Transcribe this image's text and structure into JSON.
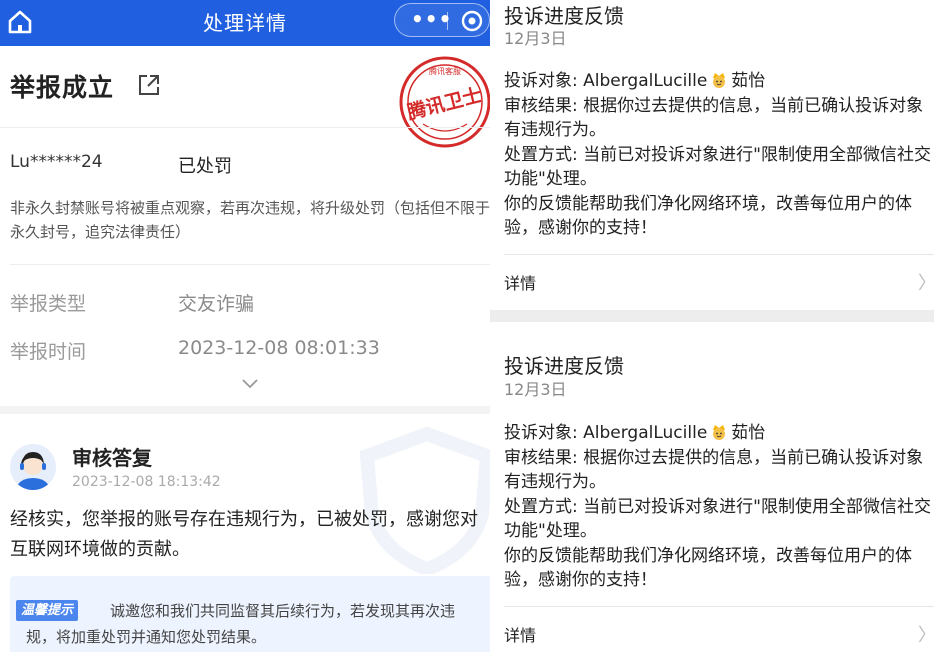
{
  "left": {
    "topbar": {
      "title": "处理详情",
      "more_icon": "more-dots-icon",
      "target_icon": "record-target-icon",
      "home_icon": "home-icon"
    },
    "report": {
      "title": "举报成立",
      "stamp_text": "腾讯卫士",
      "stamp_small_text": "腾讯客服",
      "account": "Lu******24",
      "status": "已处罚",
      "notice": "非永久封禁账号将被重点观察，若再次违规，将升级处罚（包括但不限于永久封号，追究法律责任）",
      "fields": [
        {
          "label": "举报类型",
          "value": "交友诈骗"
        },
        {
          "label": "举报时间",
          "value": "2023-12-08 08:01:33"
        }
      ]
    },
    "reply": {
      "title": "审核答复",
      "time": "2023-12-08 18:13:42",
      "text": "经核实，您举报的账号存在违规行为，已被处罚，感谢您对互联网环境做的贡献。",
      "tip_badge": "温馨提示",
      "tip_text": "诚邀您和我们共同监督其后续行为，若发现其再次违规，将加重处罚并通知您处罚结果。"
    }
  },
  "right": {
    "feedback": [
      {
        "title": "投诉进度反馈",
        "date": "12月3日",
        "target_label": "投诉对象: AlbergalLucille",
        "target_suffix": "茹怡",
        "result": "审核结果: 根据你过去提供的信息，当前已确认投诉对象有违规行为。",
        "action": "处置方式: 当前已对投诉对象进行\"限制使用全部微信社交功能\"处理。",
        "thanks": "你的反馈能帮助我们净化网络环境，改善每位用户的体验，感谢你的支持！",
        "detail": "详情"
      },
      {
        "title": "投诉进度反馈",
        "date": "12月3日",
        "target_label": "投诉对象: AlbergalLucille",
        "target_suffix": "茹怡",
        "result": "审核结果: 根据你过去提供的信息，当前已确认投诉对象有违规行为。",
        "action": "处置方式: 当前已对投诉对象进行\"限制使用全部微信社交功能\"处理。",
        "thanks": "你的反馈能帮助我们净化网络环境，改善每位用户的体验，感谢你的支持！",
        "detail": "详情"
      }
    ]
  },
  "colors": {
    "brand_blue": "#1f5fe0",
    "stamp_red": "#d42a2a",
    "tip_blue": "#4a86ee"
  }
}
